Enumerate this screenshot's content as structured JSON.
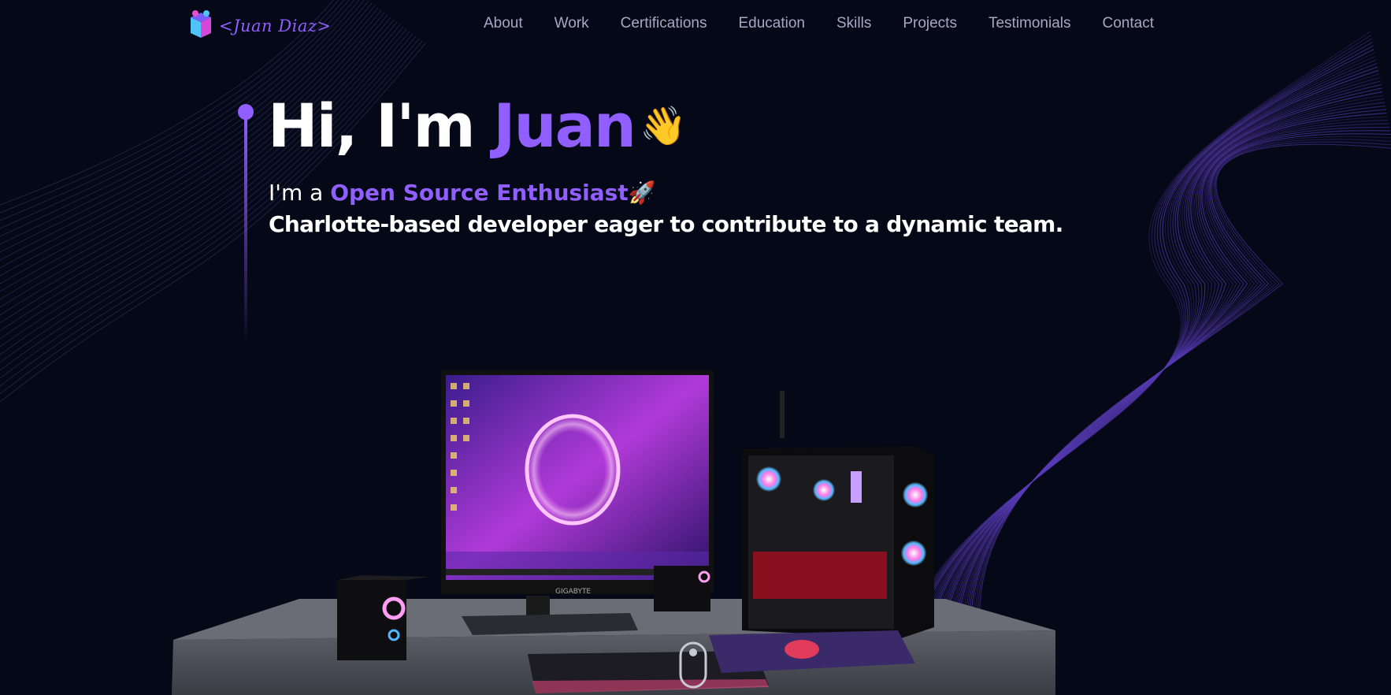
{
  "brand": {
    "name": "<Juan Diaz>",
    "accent": "#915eff"
  },
  "nav": {
    "items": [
      {
        "label": "About"
      },
      {
        "label": "Work"
      },
      {
        "label": "Certifications"
      },
      {
        "label": "Education"
      },
      {
        "label": "Skills"
      },
      {
        "label": "Projects"
      },
      {
        "label": "Testimonials"
      },
      {
        "label": "Contact"
      }
    ]
  },
  "hero": {
    "greeting": "Hi, I'm ",
    "name": "Juan",
    "wave_emoji": "👋",
    "role_prefix": "I'm a ",
    "role": "Open Source Enthusiast",
    "role_emoji": "🚀",
    "description": "Charlotte-based developer eager to contribute to a dynamic team."
  },
  "colors": {
    "background": "#050816",
    "accent": "#915eff",
    "nav_text": "#aaa6c3"
  },
  "scene": {
    "monitor_brand": "GIGABYTE"
  }
}
